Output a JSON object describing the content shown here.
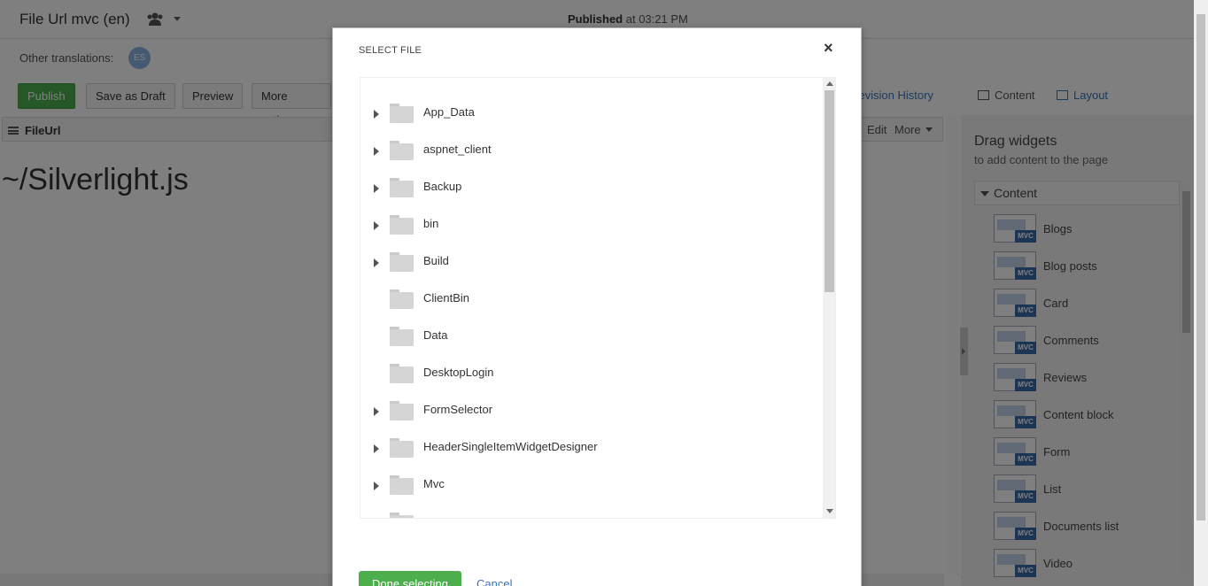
{
  "header": {
    "title": "File Url mvc (en)",
    "status_bold": "Published",
    "status_rest": " at 03:21 PM"
  },
  "translations": {
    "label": "Other translations:",
    "badge": "ES"
  },
  "toolbar": {
    "publish": "Publish",
    "save_draft": "Save as Draft",
    "preview": "Preview",
    "more_actions": "More actions",
    "revision_history": "Revision History",
    "tab_content": "Content",
    "tab_layout": "Layout"
  },
  "widget": {
    "name": "FileUrl",
    "edit": "Edit",
    "more": "More",
    "value": "~/Silverlight.js"
  },
  "sidebar": {
    "title": "Drag widgets",
    "subtitle": "to add content to the page",
    "section": "Content",
    "items": [
      {
        "label": "Blogs"
      },
      {
        "label": "Blog posts"
      },
      {
        "label": "Card"
      },
      {
        "label": "Comments"
      },
      {
        "label": "Reviews"
      },
      {
        "label": "Content block"
      },
      {
        "label": "Form"
      },
      {
        "label": "List"
      },
      {
        "label": "Documents list"
      },
      {
        "label": "Video"
      }
    ],
    "badge": "MVC"
  },
  "modal": {
    "title": "SELECT FILE",
    "close": "×",
    "folders": [
      {
        "name": "App_Data",
        "expandable": true
      },
      {
        "name": "aspnet_client",
        "expandable": true
      },
      {
        "name": "Backup",
        "expandable": true
      },
      {
        "name": "bin",
        "expandable": true
      },
      {
        "name": "Build",
        "expandable": true
      },
      {
        "name": "ClientBin",
        "expandable": false
      },
      {
        "name": "Data",
        "expandable": false
      },
      {
        "name": "DesktopLogin",
        "expandable": false
      },
      {
        "name": "FormSelector",
        "expandable": true
      },
      {
        "name": "HeaderSingleItemWidgetDesigner",
        "expandable": true
      },
      {
        "name": "Mvc",
        "expandable": true
      }
    ],
    "done": "Done selecting",
    "cancel": "Cancel"
  }
}
